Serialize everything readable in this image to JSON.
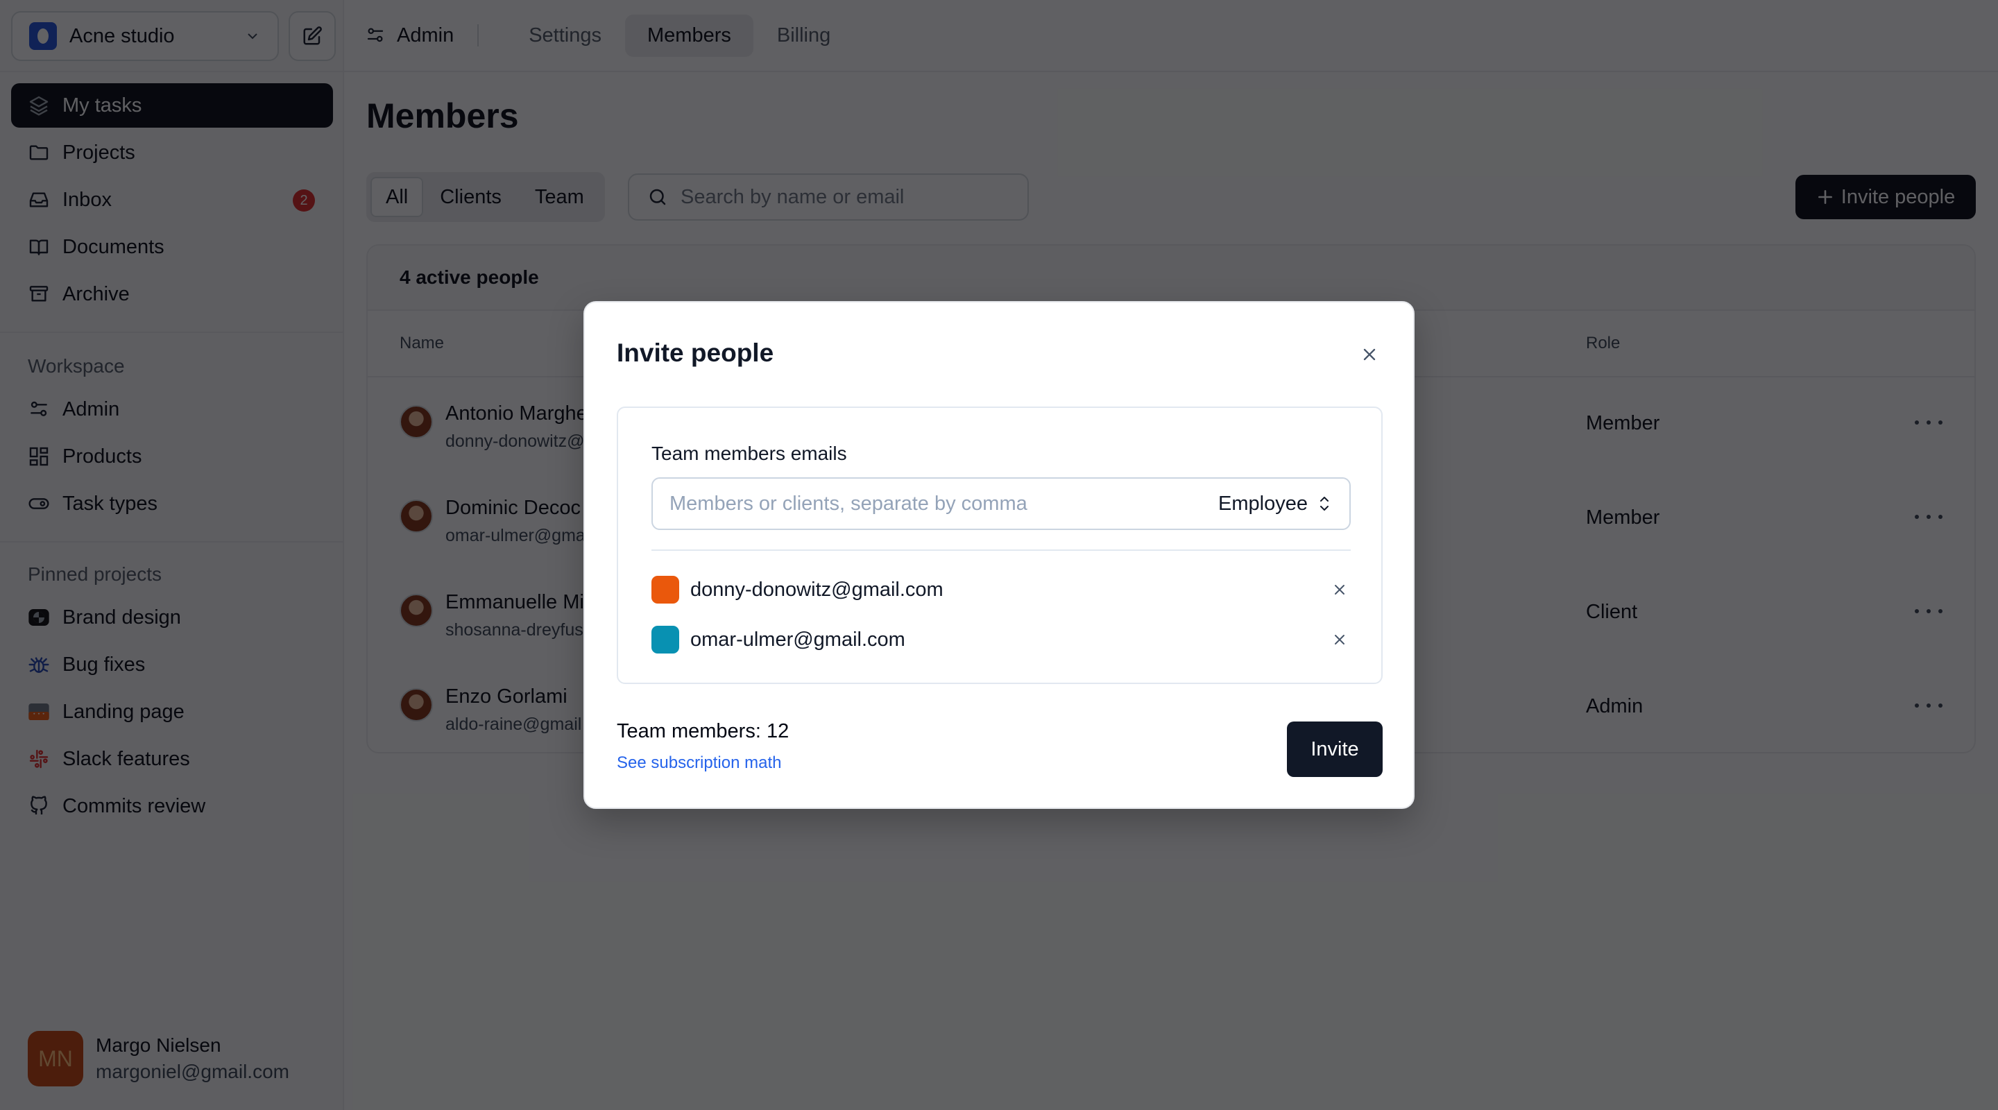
{
  "sidebar": {
    "workspace": {
      "name": "Acne studio",
      "logo_color": "#1d4ed8"
    },
    "compose_icon": "pencil-square-icon",
    "main_nav": [
      {
        "label": "My tasks",
        "icon": "layers-icon",
        "active": true
      },
      {
        "label": "Projects",
        "icon": "folder-icon",
        "active": false
      },
      {
        "label": "Inbox",
        "icon": "inbox-icon",
        "active": false,
        "badge": "2"
      },
      {
        "label": "Documents",
        "icon": "book-icon",
        "active": false
      },
      {
        "label": "Archive",
        "icon": "archive-icon",
        "active": false
      }
    ],
    "workspace_section": {
      "label": "Workspace",
      "items": [
        {
          "label": "Admin",
          "icon": "sliders-icon"
        },
        {
          "label": "Products",
          "icon": "grid-icon"
        },
        {
          "label": "Task types",
          "icon": "toggle-icon"
        }
      ]
    },
    "pinned_section": {
      "label": "Pinned projects",
      "items": [
        {
          "label": "Brand design",
          "icon": "brand-logo-icon"
        },
        {
          "label": "Bug fixes",
          "icon": "bug-icon",
          "color": "#1e40af"
        },
        {
          "label": "Landing page",
          "icon": "landing-thumbnail-icon"
        },
        {
          "label": "Slack features",
          "icon": "slack-icon",
          "color": "#b91c1c"
        },
        {
          "label": "Commits review",
          "icon": "github-icon"
        }
      ]
    },
    "user": {
      "initials": "MN",
      "name": "Margo Nielsen",
      "email": "margoniel@gmail.com",
      "avatar_color": "#c2410c"
    }
  },
  "topbar": {
    "section": "Admin",
    "tabs": [
      {
        "label": "Settings",
        "active": false
      },
      {
        "label": "Members",
        "active": true
      },
      {
        "label": "Billing",
        "active": false
      }
    ]
  },
  "main": {
    "title": "Members",
    "filters": [
      {
        "label": "All",
        "active": true
      },
      {
        "label": "Clients",
        "active": false
      },
      {
        "label": "Team",
        "active": false
      }
    ],
    "search": {
      "placeholder": "Search by name or email",
      "value": ""
    },
    "invite_button": "Invite people",
    "table": {
      "summary": "4 active people",
      "columns": {
        "name": "Name",
        "role": "Role"
      },
      "rows": [
        {
          "name": "Antonio Marghe",
          "email": "donny-donowitz@",
          "role": "Member"
        },
        {
          "name": "Dominic Decoc",
          "email": "omar-ulmer@gma",
          "role": "Member"
        },
        {
          "name": "Emmanuelle Mi",
          "email": "shosanna-dreyfus",
          "role": "Client"
        },
        {
          "name": "Enzo Gorlami",
          "email": "aldo-raine@gmail",
          "role": "Admin"
        }
      ]
    }
  },
  "modal": {
    "title": "Invite people",
    "field_label": "Team members emails",
    "input": {
      "placeholder": "Members or clients, separate by comma",
      "value": ""
    },
    "role_select": "Employee",
    "invitees": [
      {
        "email": "donny-donowitz@gmail.com",
        "color": "#ea580c"
      },
      {
        "email": "omar-ulmer@gmail.com",
        "color": "#0891b2"
      }
    ],
    "team_members_text": "Team members: 12",
    "subscription_link": "See subscription math",
    "invite_button": "Invite"
  }
}
